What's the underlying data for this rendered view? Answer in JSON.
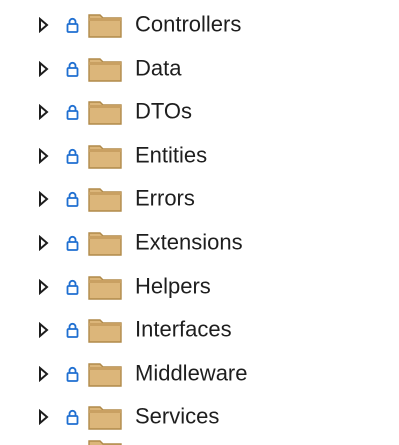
{
  "solution_explorer": {
    "folders": [
      {
        "label": "Controllers"
      },
      {
        "label": "Data"
      },
      {
        "label": "DTOs"
      },
      {
        "label": "Entities"
      },
      {
        "label": "Errors"
      },
      {
        "label": "Extensions"
      },
      {
        "label": "Helpers"
      },
      {
        "label": "Interfaces"
      },
      {
        "label": "Middleware"
      },
      {
        "label": "Services"
      }
    ],
    "icons": {
      "expander": "expand-triangle-icon",
      "lock": "lock-icon",
      "folder": "folder-icon"
    },
    "colors": {
      "expander": "#1e1e1e",
      "lock": "#1f6fd1",
      "folder_fill": "#dcb67a",
      "folder_tab": "#c9a062",
      "folder_outline": "#b08a4a",
      "text": "#1e1e1e"
    }
  }
}
